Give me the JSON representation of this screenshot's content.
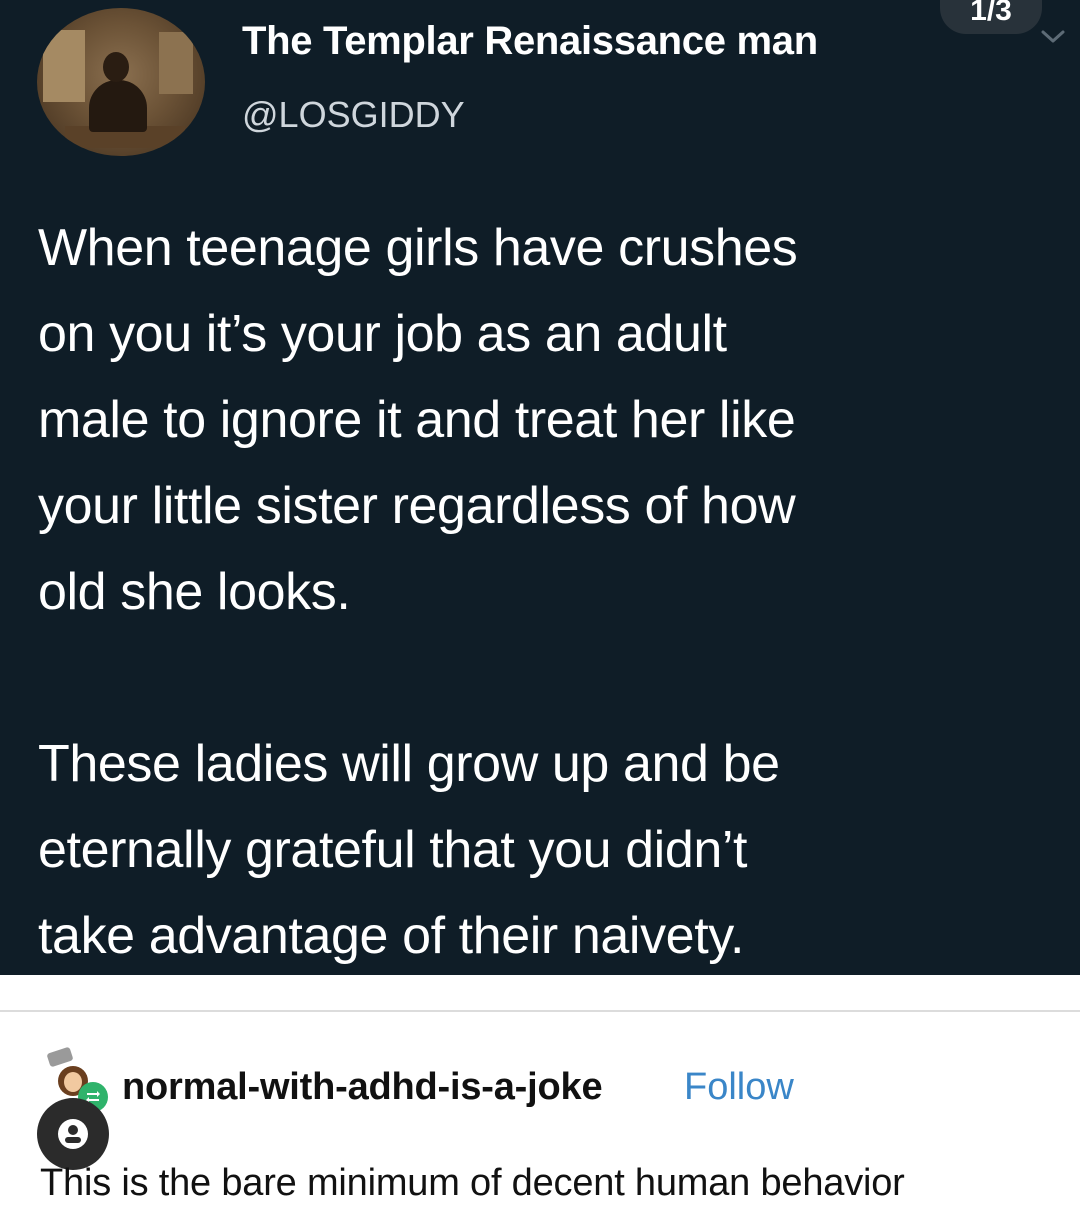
{
  "tweet": {
    "display_name": "The Templar Renaissance man",
    "handle": "@LOSGIDDY",
    "counter": "1/3",
    "paragraph_1": "When teenage girls have crushes\non you it’s your job as an adult\nmale to ignore it and treat her like\nyour little sister regardless of how\nold she looks.",
    "paragraph_2": "These ladies will grow up and be\neternally grateful that you didn’t\ntake advantage of their naivety."
  },
  "reply": {
    "username": "normal-with-adhd-is-a-joke",
    "follow_label": "Follow",
    "text": "This is the bare minimum of decent human behavior"
  },
  "colors": {
    "tweet_background": "#0f1d27",
    "link": "#3a86c8",
    "reblog_badge": "#2fb36b"
  },
  "icons": [
    "chevron-down-icon",
    "reblog-icon",
    "account-icon"
  ]
}
